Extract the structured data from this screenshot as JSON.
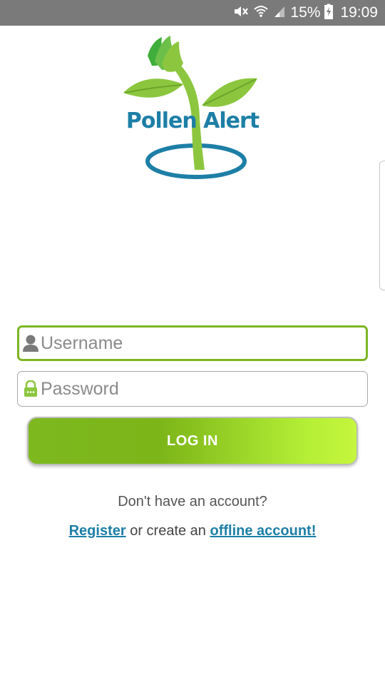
{
  "status_bar": {
    "battery_percent": "15%",
    "time": "19:09",
    "icons": [
      "mute-icon",
      "wifi-icon",
      "signal-icon",
      "battery-charging-icon"
    ]
  },
  "logo": {
    "text": "Pollen Alert",
    "colors": {
      "leaf_light": "#8cc63f",
      "leaf_dark": "#3fae3a",
      "text": "#1d7fa6",
      "ring": "#1d7fa6"
    }
  },
  "form": {
    "username": {
      "value": "",
      "placeholder": "Username",
      "icon": "user-icon"
    },
    "password": {
      "value": "",
      "placeholder": "Password",
      "icon": "lock-icon"
    },
    "login_label": "LOG IN"
  },
  "footer": {
    "no_account_text": "Don't have an account?",
    "register_label": "Register",
    "middle_text": " or create an ",
    "offline_label": "offline account!"
  },
  "colors": {
    "accent_green": "#7db524",
    "link_blue": "#1d7fa6",
    "status_bar": "#7a7a7a"
  }
}
